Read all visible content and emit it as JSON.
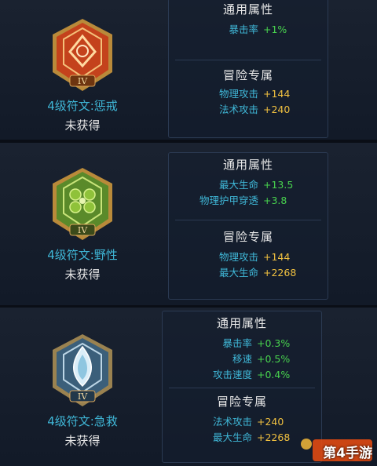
{
  "cards": [
    {
      "rune_name": "4级符文:惩戒",
      "status": "未获得",
      "badge_level": "IV",
      "common_title": "通用属性",
      "common": [
        {
          "label": "暴击率",
          "value": "+1%"
        }
      ],
      "adv_title": "冒险专属",
      "adventure": [
        {
          "label": "物理攻击",
          "value": "+144"
        },
        {
          "label": "法术攻击",
          "value": "+240"
        }
      ]
    },
    {
      "rune_name": "4级符文:野性",
      "status": "未获得",
      "badge_level": "IV",
      "common_title": "通用属性",
      "common": [
        {
          "label": "最大生命",
          "value": "+13.5"
        },
        {
          "label": "物理护甲穿透",
          "value": "+3.8"
        }
      ],
      "adv_title": "冒险专属",
      "adventure": [
        {
          "label": "物理攻击",
          "value": "+144"
        },
        {
          "label": "最大生命",
          "value": "+2268"
        }
      ]
    },
    {
      "rune_name": "4级符文:急救",
      "status": "未获得",
      "badge_level": "IV",
      "common_title": "通用属性",
      "common": [
        {
          "label": "暴击率",
          "value": "+0.3%"
        },
        {
          "label": "移速",
          "value": "+0.5%"
        },
        {
          "label": "攻击速度",
          "value": "+0.4%"
        }
      ],
      "adv_title": "冒险专属",
      "adventure": [
        {
          "label": "法术攻击",
          "value": "+240"
        },
        {
          "label": "最大生命",
          "value": "+2268"
        }
      ]
    }
  ],
  "watermark": {
    "text": "第4手游"
  },
  "colors": {
    "label": "#3fb6d6",
    "common_value": "#48d34e",
    "adventure_value": "#f0c040",
    "badge_red": "#c4421c",
    "badge_green": "#5a8a2a",
    "badge_blue": "#3b5f7a"
  }
}
